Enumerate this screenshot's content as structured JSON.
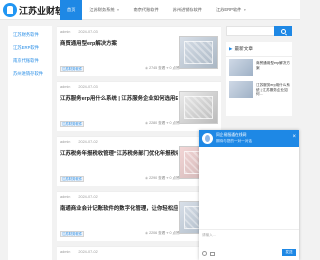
{
  "header": {
    "logo_text": "江苏业财软件",
    "nav": [
      {
        "label": "首页",
        "active": true,
        "dropdown": false
      },
      {
        "label": "江苏财务系统",
        "active": false,
        "dropdown": true
      },
      {
        "label": "南京代账软件",
        "active": false,
        "dropdown": false
      },
      {
        "label": "苏州进销存软件",
        "active": false,
        "dropdown": false
      },
      {
        "label": "江苏ERP软件",
        "active": false,
        "dropdown": true
      }
    ]
  },
  "sidebar": {
    "items": [
      {
        "label": "江苏财务软件"
      },
      {
        "label": "江苏ERP软件"
      },
      {
        "label": "南京代账软件"
      },
      {
        "label": "苏州进销存软件"
      }
    ]
  },
  "articles": [
    {
      "author": "admin",
      "date": "2024-07-03",
      "title": "商贸通用型erp解决方案",
      "tag": "江苏财务软件",
      "views": "2745 查看",
      "likes": "0 点赞"
    },
    {
      "author": "admin",
      "date": "2024-07-03",
      "title": "江苏服务erp用什么系统 | 江苏服务企业如何选用ERP系...",
      "tag": "江苏财务软件",
      "views": "2280 查看",
      "likes": "0 点赞"
    },
    {
      "author": "admin",
      "date": "2024-07-02",
      "title": "江苏税务年报税收管理“江苏税务部门优化年报税收服...",
      "tag": "江苏财务软件",
      "views": "2290 查看",
      "likes": "0 点赞"
    },
    {
      "author": "admin",
      "date": "2024-07-02",
      "title": "南通商业会计记账软件的数字化管理，让你轻松应对会...",
      "tag": "江苏财务软件",
      "views": "2206 查看",
      "likes": "0 点赞"
    },
    {
      "author": "admin",
      "date": "2024-07-02",
      "title": "",
      "tag": "",
      "views": "",
      "likes": ""
    }
  ],
  "right_panel": {
    "latest_title": "最新文章",
    "latest_items": [
      {
        "text": "商贸通用型erp解决方案"
      },
      {
        "text": "江苏服务erp用什么系统 | 江苏服务企业如何..."
      }
    ]
  },
  "chat": {
    "name": "同企易服通在线网",
    "subtitle": "期待与您的一对一对话",
    "close_label": "×",
    "input_placeholder": "请输入...",
    "send_label": "发送"
  },
  "icons": {
    "search": "search-icon",
    "latest": "flag-icon",
    "views": "eye-icon",
    "likes": "thumb-up-icon",
    "emoji": "emoji-icon",
    "image": "image-icon",
    "close": "close-icon"
  },
  "colors": {
    "accent": "#1e88e5",
    "background": "#f2f2f2"
  }
}
